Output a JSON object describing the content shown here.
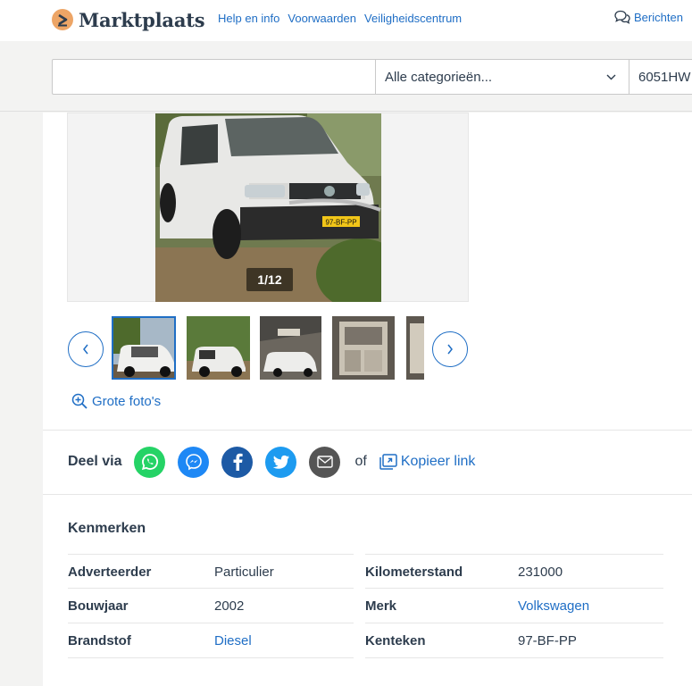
{
  "header": {
    "logo_text": "Marktplaats",
    "links": [
      "Help en info",
      "Voorwaarden",
      "Veiligheidscentrum"
    ],
    "messages_label": "Berichten"
  },
  "search": {
    "query": "",
    "category": "Alle categorieën...",
    "postcode": "6051HW"
  },
  "gallery": {
    "counter": "1/12",
    "thumbnails": [
      "thumb-1",
      "thumb-2",
      "thumb-3",
      "thumb-4",
      "thumb-5"
    ],
    "large_photos_label": "Grote foto's"
  },
  "share": {
    "label": "Deel via",
    "channels": [
      "whatsapp",
      "messenger",
      "facebook",
      "twitter",
      "email"
    ],
    "or_label": "of",
    "copy_link_label": "Kopieer link"
  },
  "specs": {
    "title": "Kenmerken",
    "left": [
      {
        "key": "Adverteerder",
        "value": "Particulier",
        "link": false
      },
      {
        "key": "Bouwjaar",
        "value": "2002",
        "link": false
      },
      {
        "key": "Brandstof",
        "value": "Diesel",
        "link": true
      }
    ],
    "right": [
      {
        "key": "Kilometerstand",
        "value": "231000",
        "link": false
      },
      {
        "key": "Merk",
        "value": "Volkswagen",
        "link": true
      },
      {
        "key": "Kenteken",
        "value": "97-BF-PP",
        "link": false
      }
    ]
  },
  "colors": {
    "link": "#1f6ec5",
    "logo_orange": "#eda566",
    "whatsapp": "#25d366",
    "messenger": "#1e88f5",
    "facebook": "#1d5aa5",
    "twitter": "#1d9bf0",
    "email": "#555555"
  },
  "vehicle": {
    "plate": "97-BF-PP"
  }
}
